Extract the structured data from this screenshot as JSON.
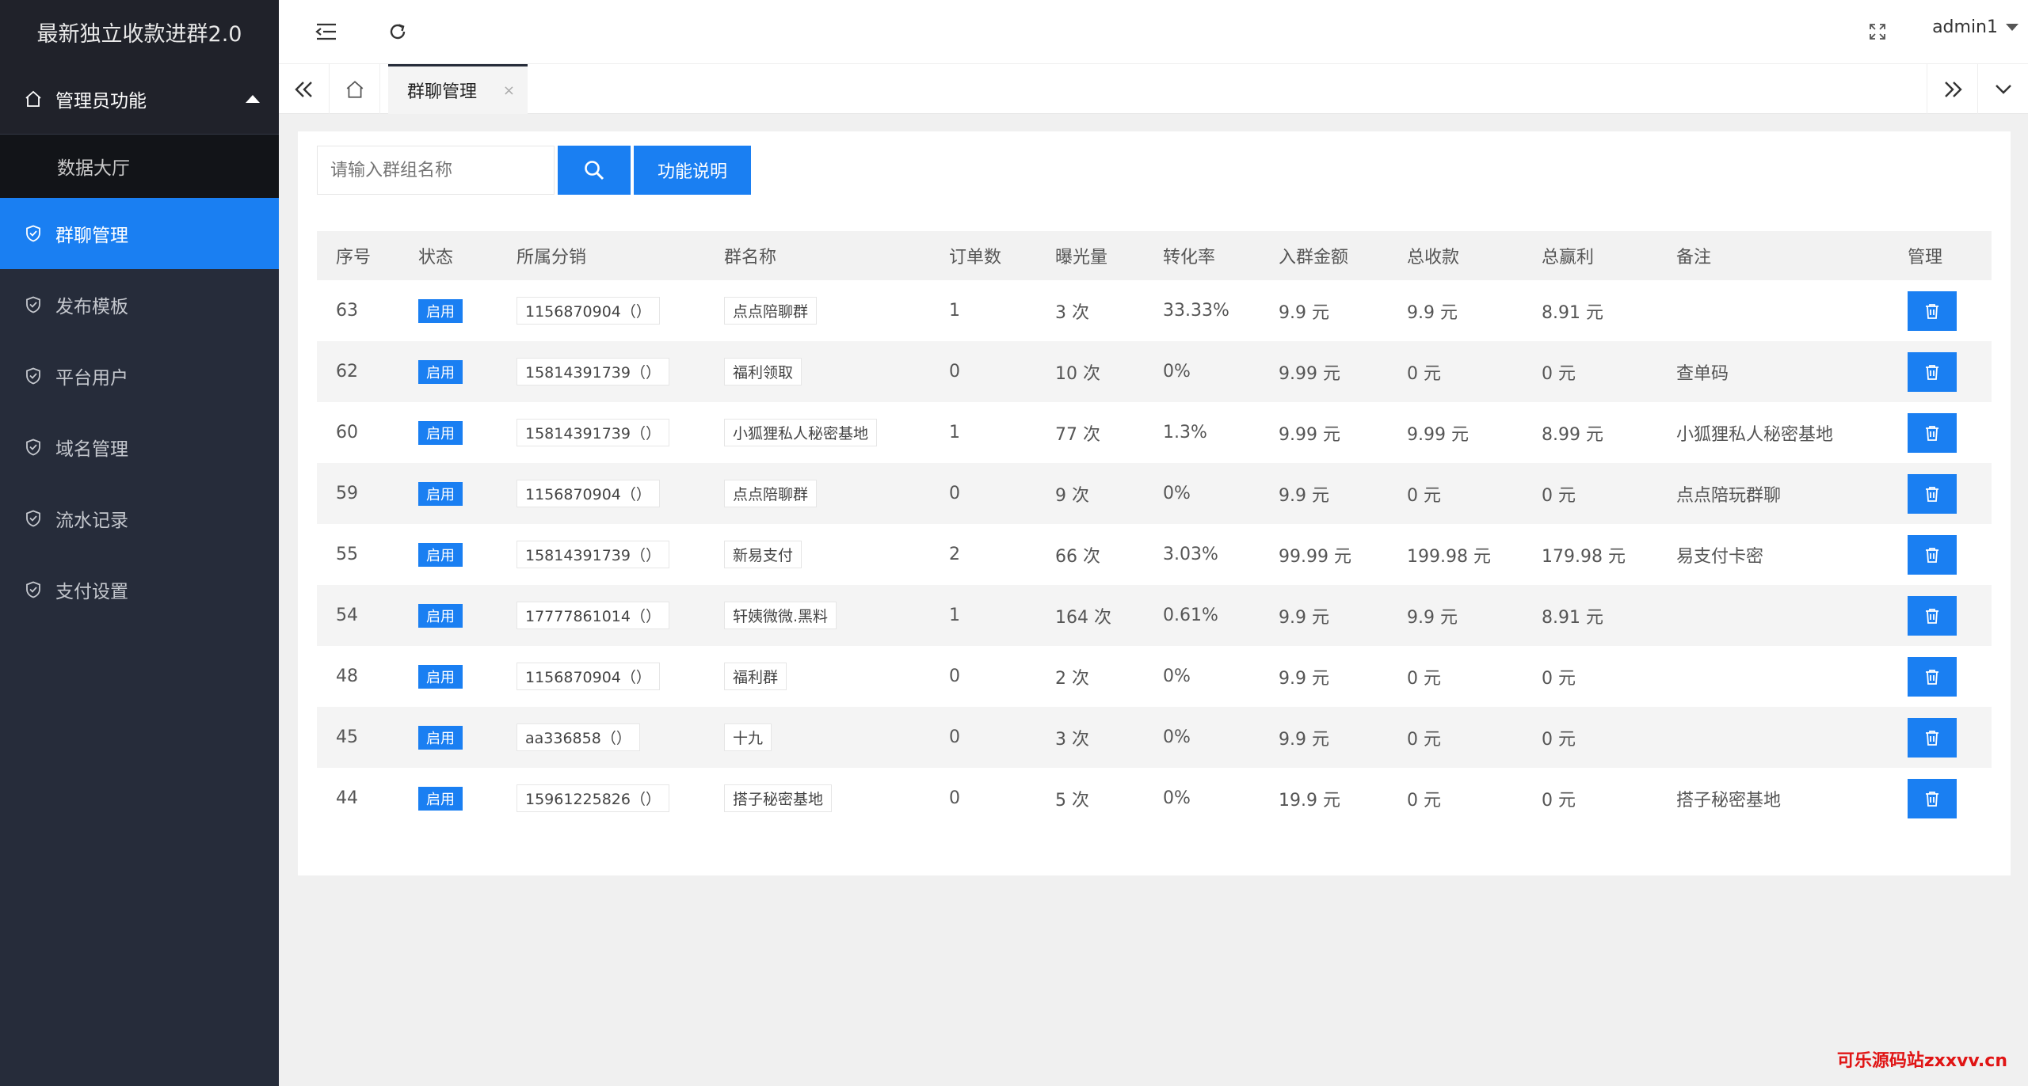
{
  "brand": {
    "title": "最新独立收款进群2.0"
  },
  "sidebar": {
    "group_label": "管理员功能",
    "sub_items": [
      "数据大厅"
    ],
    "items": [
      {
        "label": "群聊管理",
        "active": true
      },
      {
        "label": "发布模板",
        "active": false
      },
      {
        "label": "平台用户",
        "active": false
      },
      {
        "label": "域名管理",
        "active": false
      },
      {
        "label": "流水记录",
        "active": false
      },
      {
        "label": "支付设置",
        "active": false
      }
    ]
  },
  "header": {
    "user": "admin1"
  },
  "tabs": {
    "active_label": "群聊管理",
    "close_glyph": "×"
  },
  "search": {
    "placeholder": "请输入群组名称",
    "help_label": "功能说明"
  },
  "table": {
    "columns": [
      "序号",
      "状态",
      "所属分销",
      "群名称",
      "订单数",
      "曝光量",
      "转化率",
      "入群金额",
      "总收款",
      "总赢利",
      "备注",
      "管理"
    ],
    "rows": [
      [
        "63",
        "启用",
        "1156870904（）",
        "点点陪聊群",
        "1",
        "3 次",
        "33.33%",
        "9.9 元",
        "9.9 元",
        "8.91 元",
        ""
      ],
      [
        "62",
        "启用",
        "15814391739（）",
        "福利领取",
        "0",
        "10 次",
        "0%",
        "9.99 元",
        "0 元",
        "0 元",
        "查单码"
      ],
      [
        "60",
        "启用",
        "15814391739（）",
        "小狐狸私人秘密基地",
        "1",
        "77 次",
        "1.3%",
        "9.99 元",
        "9.99 元",
        "8.99 元",
        "小狐狸私人秘密基地"
      ],
      [
        "59",
        "启用",
        "1156870904（）",
        "点点陪聊群",
        "0",
        "9 次",
        "0%",
        "9.9 元",
        "0 元",
        "0 元",
        "点点陪玩群聊"
      ],
      [
        "55",
        "启用",
        "15814391739（）",
        "新易支付",
        "2",
        "66 次",
        "3.03%",
        "99.99 元",
        "199.98 元",
        "179.98 元",
        "易支付卡密"
      ],
      [
        "54",
        "启用",
        "17777861014（）",
        "轩姨微微.黑料",
        "1",
        "164 次",
        "0.61%",
        "9.9 元",
        "9.9 元",
        "8.91 元",
        ""
      ],
      [
        "48",
        "启用",
        "1156870904（）",
        "福利群",
        "0",
        "2 次",
        "0%",
        "9.9 元",
        "0 元",
        "0 元",
        ""
      ],
      [
        "45",
        "启用",
        "aa336858（）",
        "十九",
        "0",
        "3 次",
        "0%",
        "9.9 元",
        "0 元",
        "0 元",
        ""
      ],
      [
        "44",
        "启用",
        "15961225826（）",
        "搭子秘密基地",
        "0",
        "5 次",
        "0%",
        "19.9 元",
        "0 元",
        "0 元",
        "搭子秘密基地"
      ]
    ]
  },
  "watermark": "可乐源码站zxxvv.cn",
  "colors": {
    "primary": "#1a7ff2",
    "sidebar_bg": "#262c3a",
    "watermark": "#e01515"
  }
}
